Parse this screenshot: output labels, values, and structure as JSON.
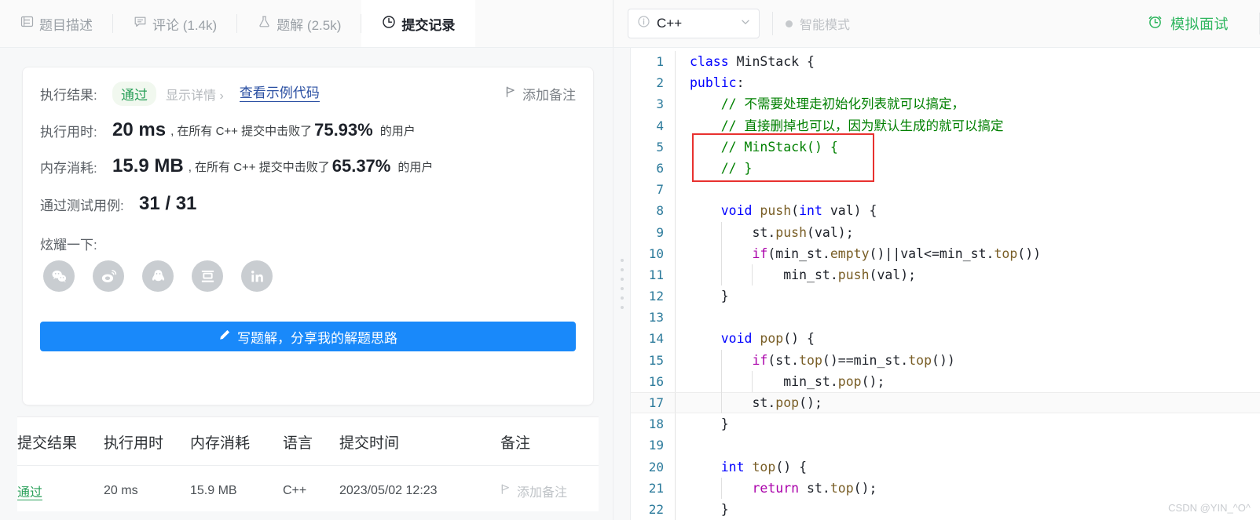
{
  "topbar": {
    "tabs": [
      {
        "label": "题目描述",
        "icon": "description-icon",
        "active": false
      },
      {
        "label": "评论 (1.4k)",
        "icon": "comment-icon",
        "active": false
      },
      {
        "label": "题解 (2.5k)",
        "icon": "flask-icon",
        "active": false
      },
      {
        "label": "提交记录",
        "icon": "clock-icon",
        "active": true
      }
    ],
    "language": {
      "value": "C++",
      "info_icon": "info-icon",
      "chevron": "chevron-down-icon"
    },
    "smart_mode": {
      "label": "智能模式",
      "enabled": false
    },
    "mock_interview": {
      "label": "模拟面试",
      "icon": "alarm-clock-icon",
      "color": "#2db55d"
    }
  },
  "result": {
    "exec_result_label": "执行结果:",
    "status_badge": "通过",
    "show_detail_link": "显示详情 ›",
    "sample_code_link": "查看示例代码",
    "add_note_label": "添加备注",
    "runtime_label": "执行用时:",
    "runtime_value": "20 ms",
    "runtime_text_before": ", 在所有 C++ 提交中击败了",
    "runtime_percent": "75.93%",
    "runtime_text_after": "的用户",
    "memory_label": "内存消耗:",
    "memory_value": "15.9 MB",
    "memory_text_before": ", 在所有 C++ 提交中击败了",
    "memory_percent": "65.37%",
    "memory_text_after": "的用户",
    "testcase_label": "通过测试用例:",
    "testcase_value": "31 / 31",
    "share_label": "炫耀一下:",
    "share_icons": [
      "wechat-icon",
      "weibo-icon",
      "qq-icon",
      "douban-icon",
      "linkedin-icon"
    ],
    "write_solution_button": "写题解，分享我的解题思路",
    "accent_blue": "#1989fa",
    "accent_green": "#2aa05a"
  },
  "history": {
    "columns": [
      "提交结果",
      "执行用时",
      "内存消耗",
      "语言",
      "提交时间",
      "备注"
    ],
    "rows": [
      {
        "result": "通过",
        "runtime": "20 ms",
        "memory": "15.9 MB",
        "language": "C++",
        "time": "2023/05/02 12:23",
        "note": "添加备注"
      }
    ]
  },
  "editor": {
    "highlight_line": 17,
    "red_box_lines": [
      5,
      6
    ],
    "lines": [
      {
        "n": 1,
        "tokens": [
          {
            "t": "class ",
            "c": "k"
          },
          {
            "t": "MinStack",
            "c": "id"
          },
          {
            "t": " {",
            "c": "op"
          }
        ]
      },
      {
        "n": 2,
        "tokens": [
          {
            "t": "public",
            "c": "k"
          },
          {
            "t": ":",
            "c": "op"
          }
        ]
      },
      {
        "n": 3,
        "indent": 1,
        "tokens": [
          {
            "t": "// 不需要处理走初始化列表就可以搞定，",
            "c": "cm"
          }
        ]
      },
      {
        "n": 4,
        "indent": 1,
        "tokens": [
          {
            "t": "// 直接删掉也可以，因为默认生成的就可以搞定",
            "c": "cm"
          }
        ]
      },
      {
        "n": 5,
        "indent": 1,
        "tokens": [
          {
            "t": "// MinStack() {",
            "c": "cm"
          }
        ]
      },
      {
        "n": 6,
        "indent": 1,
        "tokens": [
          {
            "t": "// }",
            "c": "cm"
          }
        ]
      },
      {
        "n": 7,
        "indent": 1,
        "tokens": []
      },
      {
        "n": 8,
        "indent": 1,
        "tokens": [
          {
            "t": "void ",
            "c": "k"
          },
          {
            "t": "push",
            "c": "fn"
          },
          {
            "t": "(",
            "c": "op"
          },
          {
            "t": "int ",
            "c": "k"
          },
          {
            "t": "val",
            "c": "id"
          },
          {
            "t": ") {",
            "c": "op"
          }
        ]
      },
      {
        "n": 9,
        "indent": 2,
        "tokens": [
          {
            "t": "st",
            "c": "id"
          },
          {
            "t": ".",
            "c": "op"
          },
          {
            "t": "push",
            "c": "fn"
          },
          {
            "t": "(val);",
            "c": "op"
          }
        ]
      },
      {
        "n": 10,
        "indent": 2,
        "tokens": [
          {
            "t": "if",
            "c": "km"
          },
          {
            "t": "(",
            "c": "op"
          },
          {
            "t": "min_st",
            "c": "id"
          },
          {
            "t": ".",
            "c": "op"
          },
          {
            "t": "empty",
            "c": "fn"
          },
          {
            "t": "()||val<=",
            "c": "op"
          },
          {
            "t": "min_st",
            "c": "id"
          },
          {
            "t": ".",
            "c": "op"
          },
          {
            "t": "top",
            "c": "fn"
          },
          {
            "t": "())",
            "c": "op"
          }
        ]
      },
      {
        "n": 11,
        "indent": 3,
        "tokens": [
          {
            "t": "min_st",
            "c": "id"
          },
          {
            "t": ".",
            "c": "op"
          },
          {
            "t": "push",
            "c": "fn"
          },
          {
            "t": "(val);",
            "c": "op"
          }
        ]
      },
      {
        "n": 12,
        "indent": 1,
        "tokens": [
          {
            "t": "}",
            "c": "op"
          }
        ]
      },
      {
        "n": 13,
        "indent": 0,
        "tokens": []
      },
      {
        "n": 14,
        "indent": 1,
        "tokens": [
          {
            "t": "void ",
            "c": "k"
          },
          {
            "t": "pop",
            "c": "fn"
          },
          {
            "t": "() {",
            "c": "op"
          }
        ]
      },
      {
        "n": 15,
        "indent": 2,
        "tokens": [
          {
            "t": "if",
            "c": "km"
          },
          {
            "t": "(",
            "c": "op"
          },
          {
            "t": "st",
            "c": "id"
          },
          {
            "t": ".",
            "c": "op"
          },
          {
            "t": "top",
            "c": "fn"
          },
          {
            "t": "()==",
            "c": "op"
          },
          {
            "t": "min_st",
            "c": "id"
          },
          {
            "t": ".",
            "c": "op"
          },
          {
            "t": "top",
            "c": "fn"
          },
          {
            "t": "())",
            "c": "op"
          }
        ]
      },
      {
        "n": 16,
        "indent": 3,
        "tokens": [
          {
            "t": "min_st",
            "c": "id"
          },
          {
            "t": ".",
            "c": "op"
          },
          {
            "t": "pop",
            "c": "fn"
          },
          {
            "t": "();",
            "c": "op"
          }
        ]
      },
      {
        "n": 17,
        "indent": 2,
        "tokens": [
          {
            "t": "st",
            "c": "id"
          },
          {
            "t": ".",
            "c": "op"
          },
          {
            "t": "pop",
            "c": "fn"
          },
          {
            "t": "();",
            "c": "op"
          }
        ]
      },
      {
        "n": 18,
        "indent": 1,
        "tokens": [
          {
            "t": "}",
            "c": "op"
          }
        ]
      },
      {
        "n": 19,
        "indent": 0,
        "tokens": []
      },
      {
        "n": 20,
        "indent": 1,
        "tokens": [
          {
            "t": "int ",
            "c": "k"
          },
          {
            "t": "top",
            "c": "fn"
          },
          {
            "t": "() {",
            "c": "op"
          }
        ]
      },
      {
        "n": 21,
        "indent": 2,
        "tokens": [
          {
            "t": "return ",
            "c": "km"
          },
          {
            "t": "st",
            "c": "id"
          },
          {
            "t": ".",
            "c": "op"
          },
          {
            "t": "top",
            "c": "fn"
          },
          {
            "t": "();",
            "c": "op"
          }
        ]
      },
      {
        "n": 22,
        "indent": 1,
        "tokens": [
          {
            "t": "}",
            "c": "op"
          }
        ]
      }
    ]
  },
  "watermark": "CSDN @YIN_^O^"
}
